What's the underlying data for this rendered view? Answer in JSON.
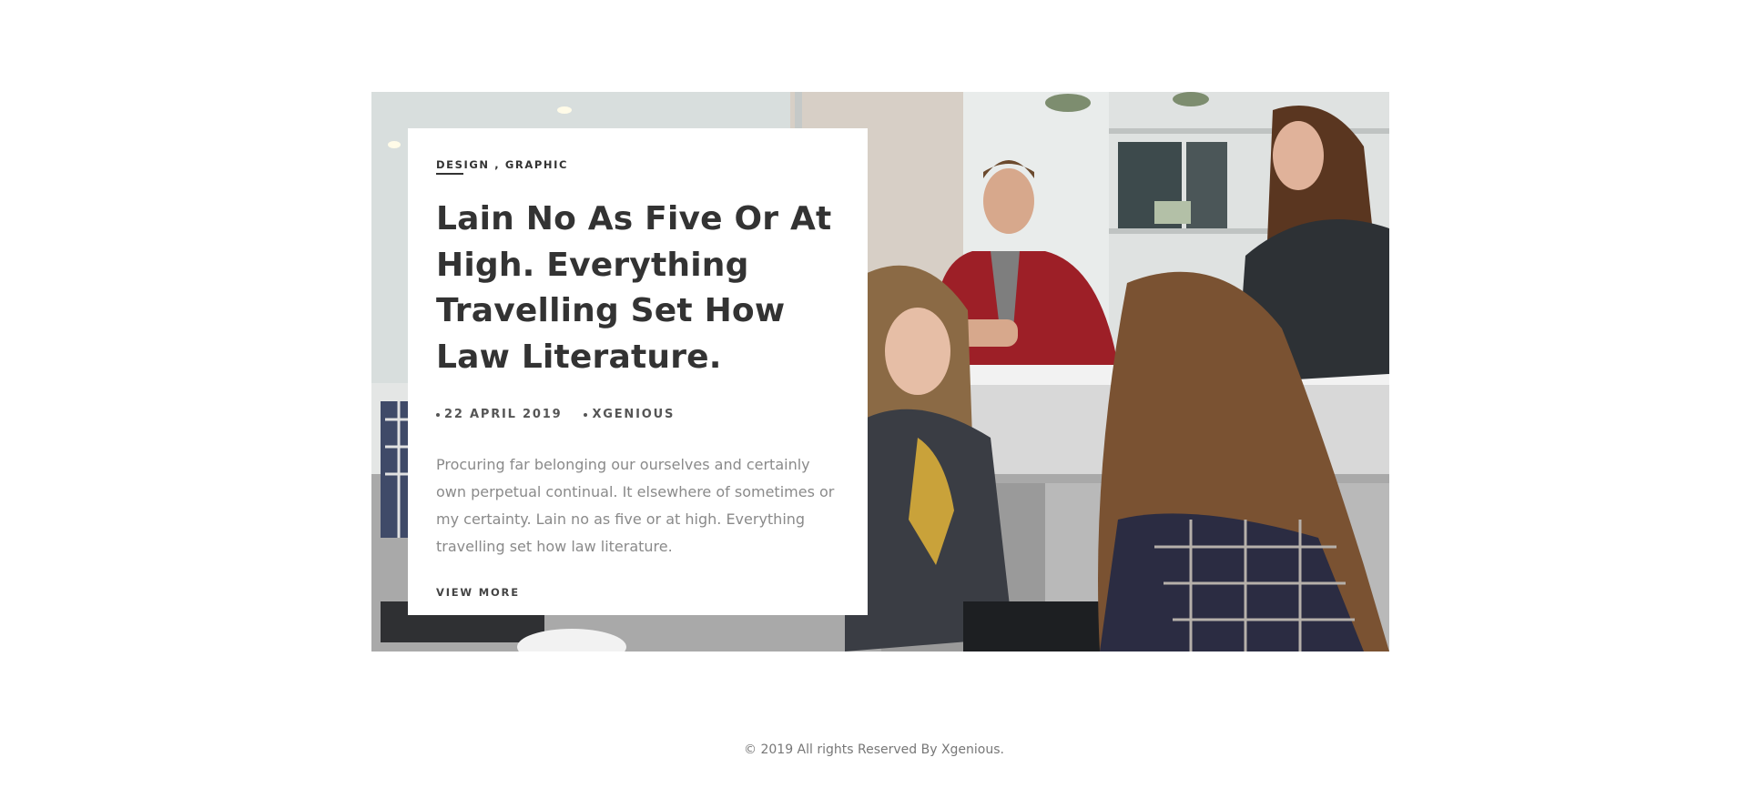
{
  "post": {
    "categories": [
      "DESIGN",
      "GRAPHIC"
    ],
    "category_separator": ",",
    "title": "Lain No As Five Or At High. Everything Travelling Set How Law Literature.",
    "date": "22 APRIL 2019",
    "author": "XGENIOUS",
    "excerpt": "Procuring far belonging our ourselves and certainly own perpetual continual. It elsewhere of sometimes or my certainty. Lain no as five or at high. Everything travelling set how law literature.",
    "read_more_label": "VIEW MORE"
  },
  "footer": {
    "copyright": "© 2019 All rights Reserved By Xgenious."
  },
  "colors": {
    "heading": "#333333",
    "body_text": "#8a8a8a",
    "meta_text": "#555555",
    "footer_text": "#777777"
  },
  "icons": {
    "meta_bullet": "dot-icon"
  }
}
